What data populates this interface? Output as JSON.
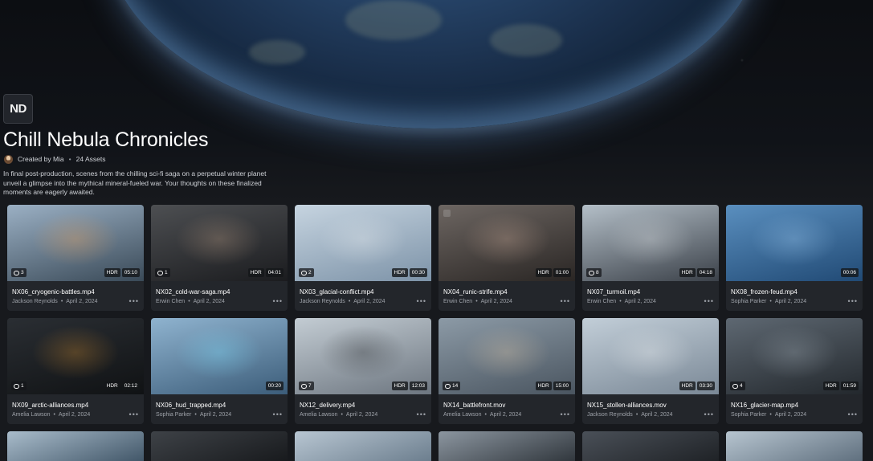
{
  "header": {
    "logo_text": "ND",
    "title": "Chill Nebula Chronicles",
    "created_by": "Created by Mia",
    "assets": "24 Assets",
    "description": "In final post-production, scenes from the chilling sci-fi saga on a perpetual winter planet unveil a glimpse into the mythical mineral-fueled war. Your thoughts on these finalized moments are eagerly awaited."
  },
  "assets": [
    {
      "name": "NX06_cryogenic-battles.mp4",
      "author": "Jackson Reynolds",
      "date": "April 2, 2024",
      "comments": "3",
      "hdr": "HDR",
      "duration": "05:10",
      "thumb_colors": [
        "#9bb0c4",
        "#3a4a58"
      ],
      "accent": "#e9a25c"
    },
    {
      "name": "NX02_cold-war-saga.mp4",
      "author": "Erwin Chen",
      "date": "April 2, 2024",
      "comments": "1",
      "hdr": "HDR",
      "duration": "04:01",
      "thumb_colors": [
        "#4d4f52",
        "#1b1c1f"
      ],
      "accent": "#b79a82"
    },
    {
      "name": "NX03_glacial-conflict.mp4",
      "author": "Jackson Reynolds",
      "date": "April 2, 2024",
      "comments": "2",
      "hdr": "HDR",
      "duration": "00:30",
      "thumb_colors": [
        "#c6d4e0",
        "#7d93a8"
      ],
      "accent": "#e8ecef"
    },
    {
      "name": "NX04_runic-strife.mp4",
      "author": "Erwin Chen",
      "date": "April 2, 2024",
      "comments": "",
      "hdr": "HDR",
      "duration": "01:00",
      "thumb_colors": [
        "#6d6662",
        "#2a2624"
      ],
      "accent": "#c8a896"
    },
    {
      "name": "NX07_turmoil.mp4",
      "author": "Erwin Chen",
      "date": "April 2, 2024",
      "comments": "8",
      "hdr": "HDR",
      "duration": "04:18",
      "thumb_colors": [
        "#b4bfc8",
        "#3b4149"
      ],
      "accent": "#d9dde0"
    },
    {
      "name": "NX08_frozen-feud.mp4",
      "author": "Sophia Parker",
      "date": "April 2, 2024",
      "comments": "",
      "hdr": "",
      "duration": "00:06",
      "thumb_colors": [
        "#5a8fbf",
        "#214a75"
      ],
      "accent": "#9cc8ee"
    },
    {
      "name": "NX09_arctic-alliances.mp4",
      "author": "Amelia Lawson",
      "date": "April 2, 2024",
      "comments": "1",
      "hdr": "HDR",
      "duration": "02:12",
      "thumb_colors": [
        "#2a2e33",
        "#101214"
      ],
      "accent": "#c7872f"
    },
    {
      "name": "NX06_hud_trapped.mp4",
      "author": "Sophia Parker",
      "date": "April 2, 2024",
      "comments": "",
      "hdr": "",
      "duration": "00:20",
      "thumb_colors": [
        "#8fb3cf",
        "#3c5d7a"
      ],
      "accent": "#7fe0ff"
    },
    {
      "name": "NX12_delivery.mp4",
      "author": "Amelia Lawson",
      "date": "April 2, 2024",
      "comments": "7",
      "hdr": "HDR",
      "duration": "12:03",
      "thumb_colors": [
        "#c3ccd3",
        "#6d7680"
      ],
      "accent": "#2b2d30"
    },
    {
      "name": "NX14_battlefront.mov",
      "author": "Amelia Lawson",
      "date": "April 2, 2024",
      "comments": "14",
      "hdr": "HDR",
      "duration": "15:00",
      "thumb_colors": [
        "#8c9aa6",
        "#4a5560"
      ],
      "accent": "#d9c4a7"
    },
    {
      "name": "NX15_stollen-alliances.mov",
      "author": "Jackson Reynolds",
      "date": "April 2, 2024",
      "comments": "",
      "hdr": "HDR",
      "duration": "03:30",
      "thumb_colors": [
        "#c2ced8",
        "#7a8896"
      ],
      "accent": "#eef1f3"
    },
    {
      "name": "NX16_glacier-map.mp4",
      "author": "Sophia Parker",
      "date": "April 2, 2024",
      "comments": "4",
      "hdr": "HDR",
      "duration": "01:59",
      "thumb_colors": [
        "#5e6872",
        "#23282d"
      ],
      "accent": "#9aa5ae"
    }
  ],
  "partial_row_colors": [
    [
      "#a9bccb",
      "#3f5466"
    ],
    [
      "#3e4247",
      "#17191c"
    ],
    [
      "#b8c6d2",
      "#6a7c8c"
    ],
    [
      "#8c96a0",
      "#2e343a"
    ],
    [
      "#4a5058",
      "#1e2125"
    ],
    [
      "#b7c5d0",
      "#5d6d7c"
    ]
  ],
  "more_icon": "more-horizontal-icon",
  "comment_icon": "comment-bubble-icon"
}
